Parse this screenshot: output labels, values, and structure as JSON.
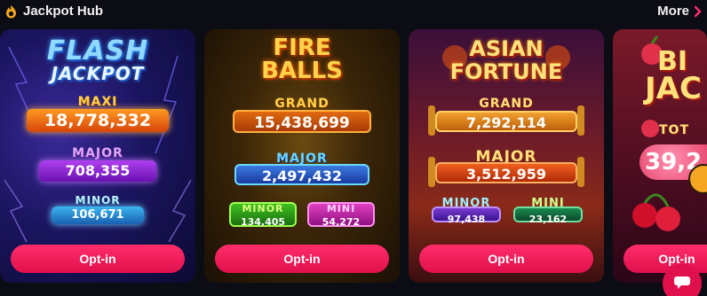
{
  "header": {
    "title": "Jackpot Hub",
    "more_label": "More"
  },
  "colors": {
    "accent": "#e0104d",
    "background": "#0b0c14",
    "hub_icon": "#f5a623"
  },
  "cards": [
    {
      "logo_line1": "FLASH",
      "logo_line2": "JACKPOT",
      "tiers": [
        {
          "label": "MAXI",
          "value": "18,778,332"
        },
        {
          "label": "MAJOR",
          "value": "708,355"
        },
        {
          "label": "MINOR",
          "value": "106,671"
        }
      ],
      "button_label": "Opt-in"
    },
    {
      "logo_line1": "FIRE",
      "logo_line2": "BALLS",
      "tiers": [
        {
          "label": "GRAND",
          "value": "15,438,699"
        },
        {
          "label": "MAJOR",
          "value": "2,497,432"
        },
        {
          "label": "MINOR",
          "value": "134,405"
        },
        {
          "label": "MINI",
          "value": "54,272"
        }
      ],
      "button_label": "Opt-in"
    },
    {
      "logo_line1": "ASIAN",
      "logo_line2": "FORTUNE",
      "tiers": [
        {
          "label": "GRAND",
          "value": "7,292,114"
        },
        {
          "label": "MAJOR",
          "value": "3,512,959"
        },
        {
          "label": "MINOR",
          "value": "97,438"
        },
        {
          "label": "MINI",
          "value": "23,162"
        }
      ],
      "button_label": "Opt-in"
    },
    {
      "logo_line1": "BI",
      "logo_line2": "JAC",
      "tiers": [
        {
          "label": "TOT",
          "value": "39,2"
        }
      ],
      "button_label": "Opt-in"
    }
  ],
  "icons": {
    "hub": "flame-icon",
    "more": "chevron-right-icon",
    "chat": "chat-bubble-icon",
    "side_badge": "partial-badge-icon"
  }
}
